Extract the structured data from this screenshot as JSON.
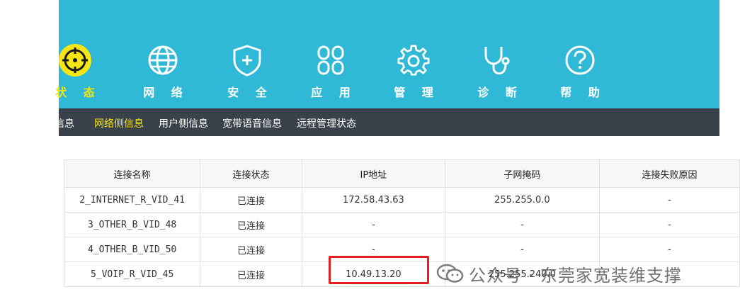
{
  "nav": {
    "items": [
      {
        "label": "状 态",
        "icon": "status-target-icon",
        "active": true
      },
      {
        "label": "网 络",
        "icon": "globe-icon",
        "active": false
      },
      {
        "label": "安 全",
        "icon": "shield-plus-icon",
        "active": false
      },
      {
        "label": "应 用",
        "icon": "app-grid-icon",
        "active": false
      },
      {
        "label": "管 理",
        "icon": "gear-icon",
        "active": false
      },
      {
        "label": "诊 断",
        "icon": "stethoscope-icon",
        "active": false
      },
      {
        "label": "帮 助",
        "icon": "help-icon",
        "active": false
      }
    ]
  },
  "subnav": {
    "items": [
      {
        "label": "信息",
        "active": false
      },
      {
        "label": "网络侧信息",
        "active": true
      },
      {
        "label": "用户侧信息",
        "active": false
      },
      {
        "label": "宽带语音信息",
        "active": false
      },
      {
        "label": "远程管理状态",
        "active": false
      }
    ]
  },
  "table": {
    "headers": [
      "连接名称",
      "连接状态",
      "IP地址",
      "子网掩码",
      "连接失败原因"
    ],
    "rows": [
      [
        "2_INTERNET_R_VID_41",
        "已连接",
        "172.58.43.63",
        "255.255.0.0",
        "-"
      ],
      [
        "3_OTHER_B_VID_48",
        "已连接",
        "-",
        "-",
        "-"
      ],
      [
        "4_OTHER_B_VID_50",
        "已连接",
        "-",
        "-",
        "-"
      ],
      [
        "5_VOIP_R_VID_45",
        "已连接",
        "10.49.13.20",
        "255.255.240.0",
        ""
      ]
    ]
  },
  "watermark": {
    "text": "公众号 · 东莞家宽装维支撑",
    "icon": "wechat-icon"
  },
  "colors": {
    "banner": "#2fb9d6",
    "subnav": "#39414a",
    "active": "#f5e50e",
    "highlight": "#e02020"
  }
}
